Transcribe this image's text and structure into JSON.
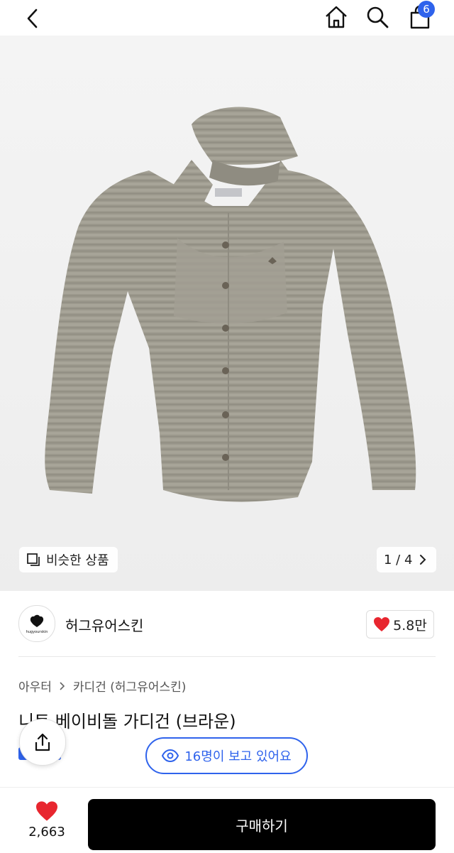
{
  "header": {
    "back_icon": "chevron-left-icon",
    "home_icon": "home-icon",
    "search_icon": "search-icon",
    "cart_icon": "shopping-bag-icon",
    "cart_badge": "6",
    "badge_color": "#2f63ec"
  },
  "gallery": {
    "similar_label": "비슷한 상품",
    "counter": "1 / 4"
  },
  "brand": {
    "name": "허그유어스킨",
    "logo_text": "hugyourskin",
    "likes": "5.8만"
  },
  "product": {
    "breadcrumb": [
      "아우터",
      "카디건 (허그유어스킨)"
    ],
    "title": "니트 베이비돌 가디건 (브라운)",
    "viewing": "16명이 보고 있어요"
  },
  "footer": {
    "wish_count": "2,663",
    "buy_label": "구매하기",
    "heart_color": "#e8262f"
  }
}
